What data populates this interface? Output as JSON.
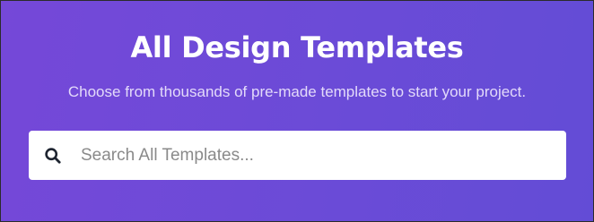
{
  "hero": {
    "title": "All Design Templates",
    "subtitle": "Choose from thousands of pre-made templates to start your project.",
    "background_colors": [
      "#7548d8",
      "#634cd6"
    ]
  },
  "search": {
    "icon": "search-icon",
    "placeholder": "Search All Templates...",
    "value": ""
  }
}
